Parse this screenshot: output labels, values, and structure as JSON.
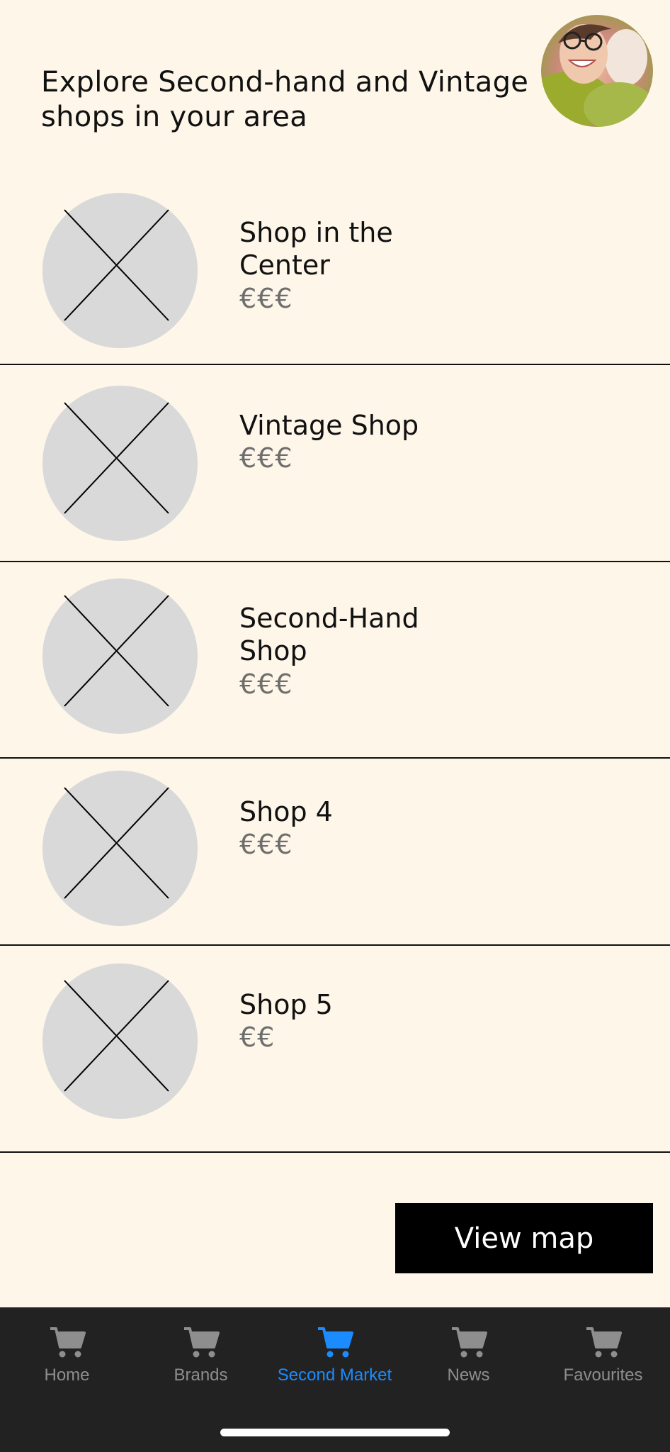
{
  "header": {
    "title_line1": "Explore Second-hand and Vintage",
    "title_line2": "shops in your area"
  },
  "shops": [
    {
      "name_line1": "Shop in the",
      "name_line2": "Center",
      "price": "€€€"
    },
    {
      "name_line1": "Vintage Shop",
      "name_line2": "",
      "price": "€€€"
    },
    {
      "name_line1": "Second-Hand",
      "name_line2": "Shop",
      "price": "€€€"
    },
    {
      "name_line1": "Shop 4",
      "name_line2": "",
      "price": "€€€"
    },
    {
      "name_line1": "Shop 5",
      "name_line2": "",
      "price": "€€"
    }
  ],
  "actions": {
    "view_map_label": "View map"
  },
  "tabbar": {
    "tabs": [
      {
        "label": "Home",
        "icon": "cart-icon"
      },
      {
        "label": "Brands",
        "icon": "cart-icon"
      },
      {
        "label": "Second Market",
        "icon": "cart-icon",
        "active": true
      },
      {
        "label": "News",
        "icon": "cart-icon"
      },
      {
        "label": "Favourites",
        "icon": "cart-icon"
      }
    ],
    "active_color": "#1a8cff",
    "inactive_color": "#8e8e8e",
    "background": "#222222"
  },
  "colors": {
    "background": "#fdf6e9",
    "placeholder": "#d9d9d9",
    "button": "#000000"
  }
}
